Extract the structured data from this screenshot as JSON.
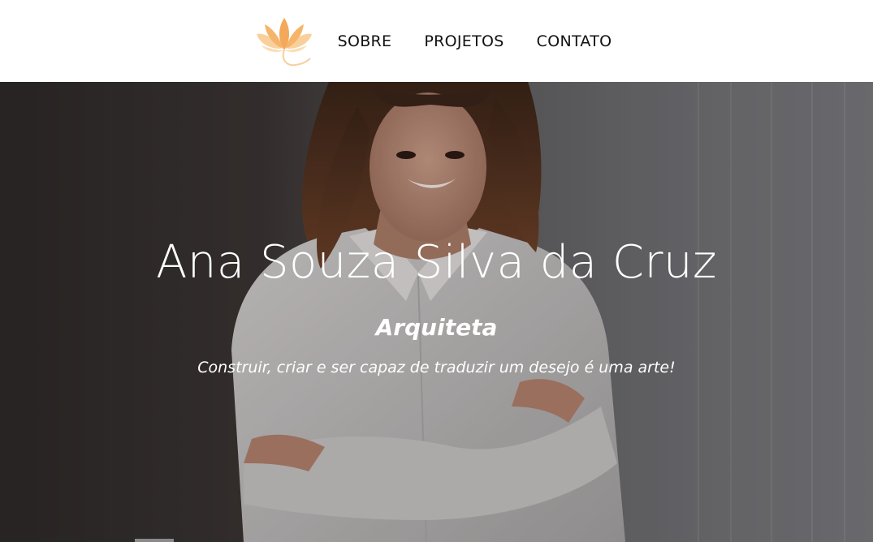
{
  "header": {
    "logo_icon": "lotus-flower-icon",
    "logo_color": "#f4a95a",
    "nav": [
      {
        "label": "SOBRE"
      },
      {
        "label": "PROJETOS"
      },
      {
        "label": "CONTATO"
      }
    ]
  },
  "hero": {
    "name": "Ana Souza Silva da Cruz",
    "role": "Arquiteta",
    "tagline": "Construir, criar e ser capaz de traduzir um desejo é uma arte!",
    "background_image": "woman-portrait-white-shirt"
  }
}
